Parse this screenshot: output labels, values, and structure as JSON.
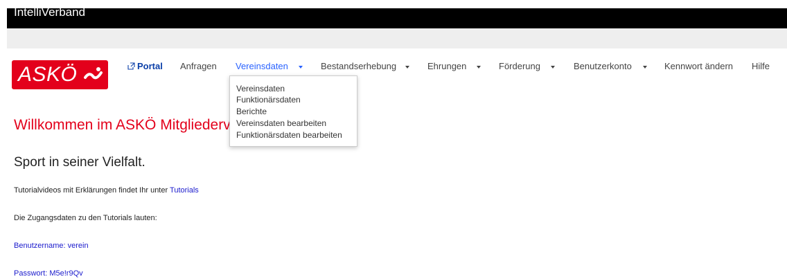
{
  "app": {
    "title": "IntelliVerband"
  },
  "logo": {
    "text": "ASKÖ"
  },
  "nav": {
    "portal": "Portal",
    "anfragen": "Anfragen",
    "vereinsdaten": "Vereinsdaten",
    "bestandserhebung": "Bestandserhebung",
    "ehrungen": "Ehrungen",
    "foerderung": "Förderung",
    "benutzerkonto": "Benutzerkonto",
    "kennwort": "Kennwort ändern",
    "hilfe": "Hilfe"
  },
  "dropdown": {
    "items": [
      "Vereinsdaten",
      "Funktionärsdaten",
      "Berichte",
      "Vereinsdaten bearbeiten",
      "Funktionärsdaten bearbeiten"
    ]
  },
  "content": {
    "welcome": "Willkommen im ASKÖ Mitgliederv",
    "subtitle": "Sport in seiner Vielfalt.",
    "tutorial_text": "Tutorialvideos mit Erklärungen findet Ihr unter ",
    "tutorial_link": "Tutorials",
    "access_text": "Die Zugangsdaten zu den Tutorials lauten:",
    "username": "Benutzername: verein",
    "password": "Passwort: M5e!r9Qv"
  },
  "colors": {
    "brand_red": "#e3001b",
    "active_nav": "#2962ff",
    "link_blue": "#1a1acc",
    "topbar": "#000000"
  },
  "icons": {
    "portal": "external-share-icon",
    "logo_mark": "asko-swoosh-logo-mark"
  }
}
